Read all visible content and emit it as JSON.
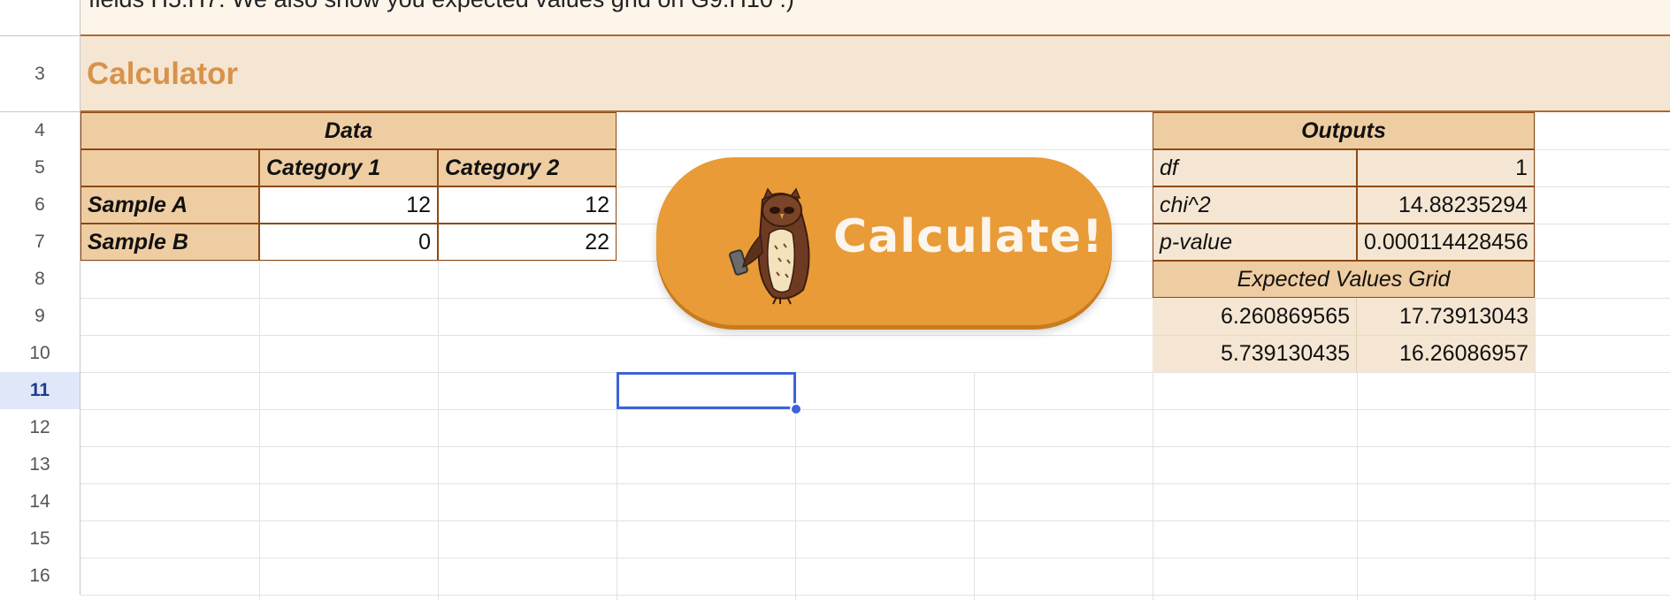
{
  "intro": {
    "text": "fields H5:H7. We also show you expected values grid on G9:H10 :)"
  },
  "calculator": {
    "title": "Calculator",
    "button_label": "Calculate!",
    "button_icon": "owl-icon"
  },
  "row_numbers": [
    "3",
    "4",
    "5",
    "6",
    "7",
    "8",
    "9",
    "10",
    "11",
    "12",
    "13",
    "14",
    "15",
    "16"
  ],
  "active_row": "11",
  "data_table": {
    "header": "Data",
    "columns": [
      "Category 1",
      "Category 2"
    ],
    "rows": [
      {
        "label": "Sample A",
        "values": [
          "12",
          "12"
        ]
      },
      {
        "label": "Sample B",
        "values": [
          "0",
          "22"
        ]
      }
    ]
  },
  "outputs": {
    "header": "Outputs",
    "rows": [
      {
        "label": "df",
        "value": "1"
      },
      {
        "label": "chi^2",
        "value": "14.88235294"
      },
      {
        "label": "p-value",
        "value": "0.000114428456"
      }
    ],
    "expected_header": "Expected Values Grid",
    "expected": [
      [
        "6.260869565",
        "17.73913043"
      ],
      [
        "5.739130435",
        "16.26086957"
      ]
    ]
  },
  "colors": {
    "accent": "#e89b36",
    "header_fill": "#efcda2",
    "band_fill": "#f5e6d3",
    "title_text": "#d8924b",
    "selection": "#3c63d8"
  }
}
